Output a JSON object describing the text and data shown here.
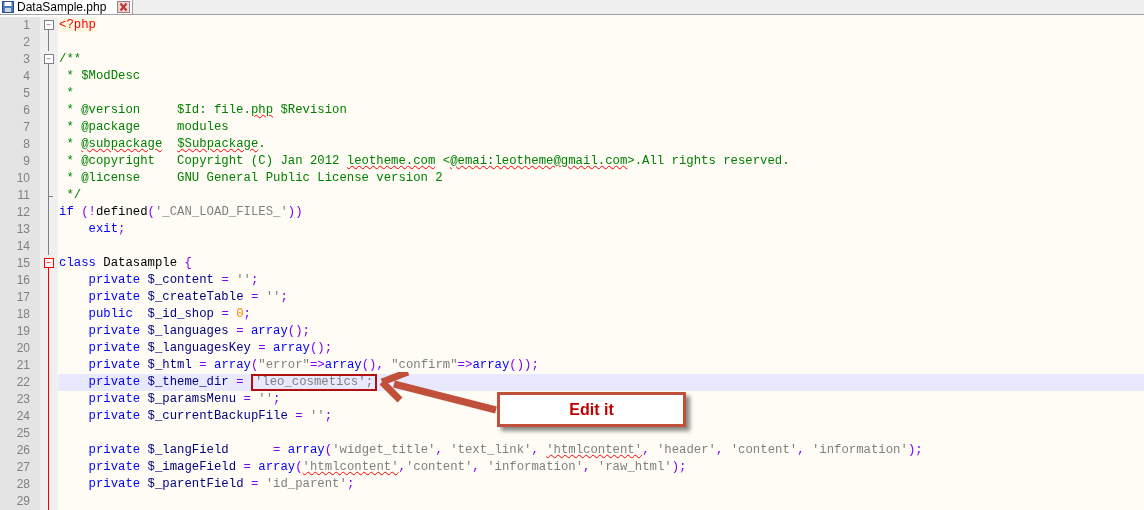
{
  "tabs": [
    {
      "label": "DataSample.php",
      "selected": true
    }
  ],
  "lines": [
    {
      "number": "1",
      "fold_start": true,
      "fold_end": false,
      "active": false,
      "current": false,
      "tokens": [
        {
          "kind": "php",
          "t": "<?php"
        }
      ]
    },
    {
      "number": "2",
      "fold_start": false,
      "fold_end": false,
      "active": false,
      "current": false
    },
    {
      "number": "3",
      "fold_start": true,
      "fold_end": false,
      "active": false,
      "current": false,
      "tokens": [
        {
          "kind": "cmt",
          "t": "/**"
        }
      ]
    },
    {
      "number": "4",
      "fold_start": false,
      "fold_end": false,
      "active": false,
      "current": false,
      "tokens": [
        {
          "kind": "cmt",
          "t": " * $ModDesc"
        }
      ]
    },
    {
      "number": "5",
      "fold_start": false,
      "fold_end": false,
      "active": false,
      "current": false,
      "tokens": [
        {
          "kind": "cmt",
          "t": " *"
        }
      ]
    },
    {
      "number": "6",
      "fold_start": false,
      "fold_end": false,
      "active": false,
      "current": false,
      "tokens": [
        {
          "kind": "cmt",
          "t": " * @version     $Id: file."
        },
        {
          "kind": "cmt",
          "t": "php",
          "spell": true
        },
        {
          "kind": "cmt",
          "t": " $Revision"
        }
      ]
    },
    {
      "number": "7",
      "fold_start": false,
      "fold_end": false,
      "active": false,
      "current": false,
      "tokens": [
        {
          "kind": "cmt",
          "t": " * @package     modules"
        }
      ]
    },
    {
      "number": "8",
      "fold_start": false,
      "fold_end": false,
      "active": false,
      "current": false,
      "tokens": [
        {
          "kind": "cmt",
          "t": " * "
        },
        {
          "kind": "cmt",
          "t": "@subpackage",
          "spell": true
        },
        {
          "kind": "cmt",
          "t": "  $Subpackage",
          "spell": true
        },
        {
          "kind": "cmt",
          "t": "."
        }
      ]
    },
    {
      "number": "9",
      "fold_start": false,
      "fold_end": false,
      "active": false,
      "current": false,
      "tokens": [
        {
          "kind": "cmt",
          "t": " * @copyright   Copyright (C) Jan 2012 "
        },
        {
          "kind": "cmt",
          "t": "leotheme.com",
          "spell": true
        },
        {
          "kind": "cmt",
          "t": " <"
        },
        {
          "kind": "cmt",
          "t": "@emai:leotheme@gmail.com",
          "spell": true
        },
        {
          "kind": "cmt",
          "t": ">.All rights reserved."
        }
      ]
    },
    {
      "number": "10",
      "fold_start": false,
      "fold_end": false,
      "active": false,
      "current": false,
      "tokens": [
        {
          "kind": "cmt",
          "t": " * @license     GNU General Public License version 2"
        }
      ]
    },
    {
      "number": "11",
      "fold_start": false,
      "fold_end": true,
      "active": false,
      "current": false,
      "tokens": [
        {
          "kind": "cmt",
          "t": " */"
        }
      ]
    },
    {
      "number": "12",
      "fold_start": false,
      "fold_end": false,
      "active": false,
      "current": false,
      "tokens": [
        {
          "kind": "kw",
          "t": "if "
        },
        {
          "kind": "op",
          "t": "(!"
        },
        {
          "kind": "id",
          "t": "defined"
        },
        {
          "kind": "op",
          "t": "("
        },
        {
          "kind": "str",
          "t": "'_CAN_LOAD_FILES_'"
        },
        {
          "kind": "op",
          "t": "))"
        }
      ]
    },
    {
      "number": "13",
      "fold_start": false,
      "fold_end": false,
      "active": false,
      "current": false,
      "tokens": [
        {
          "kind": "kw",
          "t": "    exit"
        },
        {
          "kind": "op",
          "t": ";"
        }
      ]
    },
    {
      "number": "14",
      "fold_start": false,
      "fold_end": false,
      "active": false,
      "current": false
    },
    {
      "number": "15",
      "fold_start": true,
      "fold_end": false,
      "active": true,
      "current": false,
      "tokens": [
        {
          "kind": "kw",
          "t": "class"
        },
        {
          "kind": "id",
          "t": " Datasample "
        },
        {
          "kind": "op",
          "t": "{"
        }
      ]
    },
    {
      "number": "16",
      "fold_start": false,
      "fold_end": false,
      "active": true,
      "current": false,
      "tokens": [
        {
          "kind": "kw",
          "t": "    private "
        },
        {
          "kind": "var",
          "t": "$_content"
        },
        {
          "kind": "op",
          "t": " = "
        },
        {
          "kind": "str",
          "t": "''"
        },
        {
          "kind": "op",
          "t": ";"
        }
      ]
    },
    {
      "number": "17",
      "fold_start": false,
      "fold_end": false,
      "active": true,
      "current": false,
      "tokens": [
        {
          "kind": "kw",
          "t": "    private "
        },
        {
          "kind": "var",
          "t": "$_createTable"
        },
        {
          "kind": "op",
          "t": " = "
        },
        {
          "kind": "str",
          "t": "''"
        },
        {
          "kind": "op",
          "t": ";"
        }
      ]
    },
    {
      "number": "18",
      "fold_start": false,
      "fold_end": false,
      "active": true,
      "current": false,
      "tokens": [
        {
          "kind": "kw",
          "t": "    public  "
        },
        {
          "kind": "var",
          "t": "$_id_shop"
        },
        {
          "kind": "op",
          "t": " = "
        },
        {
          "kind": "num",
          "t": "0"
        },
        {
          "kind": "op",
          "t": ";"
        }
      ]
    },
    {
      "number": "19",
      "fold_start": false,
      "fold_end": false,
      "active": true,
      "current": false,
      "tokens": [
        {
          "kind": "kw",
          "t": "    private "
        },
        {
          "kind": "var",
          "t": "$_languages"
        },
        {
          "kind": "op",
          "t": " = "
        },
        {
          "kind": "kw",
          "t": "array"
        },
        {
          "kind": "op",
          "t": "();"
        }
      ]
    },
    {
      "number": "20",
      "fold_start": false,
      "fold_end": false,
      "active": true,
      "current": false,
      "tokens": [
        {
          "kind": "kw",
          "t": "    private "
        },
        {
          "kind": "var",
          "t": "$_languagesKey"
        },
        {
          "kind": "op",
          "t": " = "
        },
        {
          "kind": "kw",
          "t": "array"
        },
        {
          "kind": "op",
          "t": "();"
        }
      ]
    },
    {
      "number": "21",
      "fold_start": false,
      "fold_end": false,
      "active": true,
      "current": false,
      "tokens": [
        {
          "kind": "kw",
          "t": "    private "
        },
        {
          "kind": "var",
          "t": "$_html"
        },
        {
          "kind": "op",
          "t": " = "
        },
        {
          "kind": "kw",
          "t": "array"
        },
        {
          "kind": "op",
          "t": "("
        },
        {
          "kind": "str",
          "t": "\"error\""
        },
        {
          "kind": "op",
          "t": "=>"
        },
        {
          "kind": "kw",
          "t": "array"
        },
        {
          "kind": "op",
          "t": "(), "
        },
        {
          "kind": "str",
          "t": "\"confirm\""
        },
        {
          "kind": "op",
          "t": "=>"
        },
        {
          "kind": "kw",
          "t": "array"
        },
        {
          "kind": "op",
          "t": "());"
        }
      ]
    },
    {
      "number": "22",
      "fold_start": false,
      "fold_end": false,
      "active": true,
      "current": true,
      "tokens": [
        {
          "kind": "kw",
          "t": "    private "
        },
        {
          "kind": "var",
          "t": "$_theme_dir"
        },
        {
          "kind": "op",
          "t": " = "
        },
        {
          "kind": "str",
          "t": "'leo_cosmetics';",
          "framed": true
        }
      ]
    },
    {
      "number": "23",
      "fold_start": false,
      "fold_end": false,
      "active": true,
      "current": false,
      "tokens": [
        {
          "kind": "kw",
          "t": "    private "
        },
        {
          "kind": "var",
          "t": "$_paramsMenu"
        },
        {
          "kind": "op",
          "t": " = "
        },
        {
          "kind": "str",
          "t": "''"
        },
        {
          "kind": "op",
          "t": ";"
        }
      ]
    },
    {
      "number": "24",
      "fold_start": false,
      "fold_end": false,
      "active": true,
      "current": false,
      "tokens": [
        {
          "kind": "kw",
          "t": "    private "
        },
        {
          "kind": "var",
          "t": "$_currentBackupFile"
        },
        {
          "kind": "op",
          "t": " = "
        },
        {
          "kind": "str",
          "t": "''"
        },
        {
          "kind": "op",
          "t": ";"
        }
      ]
    },
    {
      "number": "25",
      "fold_start": false,
      "fold_end": false,
      "active": true,
      "current": false
    },
    {
      "number": "26",
      "fold_start": false,
      "fold_end": false,
      "active": true,
      "current": false,
      "tokens": [
        {
          "kind": "kw",
          "t": "    private "
        },
        {
          "kind": "var",
          "t": "$_langField"
        },
        {
          "kind": "op",
          "t": "      = "
        },
        {
          "kind": "kw",
          "t": "array"
        },
        {
          "kind": "op",
          "t": "("
        },
        {
          "kind": "str",
          "t": "'widget_title'"
        },
        {
          "kind": "op",
          "t": ", "
        },
        {
          "kind": "str",
          "t": "'text_link'"
        },
        {
          "kind": "op",
          "t": ", "
        },
        {
          "kind": "str",
          "t": "'htmlcontent'",
          "spell": true
        },
        {
          "kind": "op",
          "t": ", "
        },
        {
          "kind": "str",
          "t": "'header'"
        },
        {
          "kind": "op",
          "t": ", "
        },
        {
          "kind": "str",
          "t": "'content'"
        },
        {
          "kind": "op",
          "t": ", "
        },
        {
          "kind": "str",
          "t": "'information'"
        },
        {
          "kind": "op",
          "t": ");"
        }
      ]
    },
    {
      "number": "27",
      "fold_start": false,
      "fold_end": false,
      "active": true,
      "current": false,
      "tokens": [
        {
          "kind": "kw",
          "t": "    private "
        },
        {
          "kind": "var",
          "t": "$_imageField"
        },
        {
          "kind": "op",
          "t": " = "
        },
        {
          "kind": "kw",
          "t": "array"
        },
        {
          "kind": "op",
          "t": "("
        },
        {
          "kind": "str",
          "t": "'htmlcontent'",
          "spell": true
        },
        {
          "kind": "op",
          "t": ","
        },
        {
          "kind": "str",
          "t": "'content'"
        },
        {
          "kind": "op",
          "t": ", "
        },
        {
          "kind": "str",
          "t": "'information'"
        },
        {
          "kind": "op",
          "t": ", "
        },
        {
          "kind": "str",
          "t": "'raw_html'"
        },
        {
          "kind": "op",
          "t": ");"
        }
      ]
    },
    {
      "number": "28",
      "fold_start": false,
      "fold_end": false,
      "active": true,
      "current": false,
      "tokens": [
        {
          "kind": "kw",
          "t": "    private "
        },
        {
          "kind": "var",
          "t": "$_parentField"
        },
        {
          "kind": "op",
          "t": " = "
        },
        {
          "kind": "str",
          "t": "'id_parent'"
        },
        {
          "kind": "op",
          "t": ";"
        }
      ]
    },
    {
      "number": "29",
      "fold_start": false,
      "fold_end": false,
      "active": true,
      "current": false
    }
  ],
  "annotation": {
    "label": "Edit it"
  }
}
